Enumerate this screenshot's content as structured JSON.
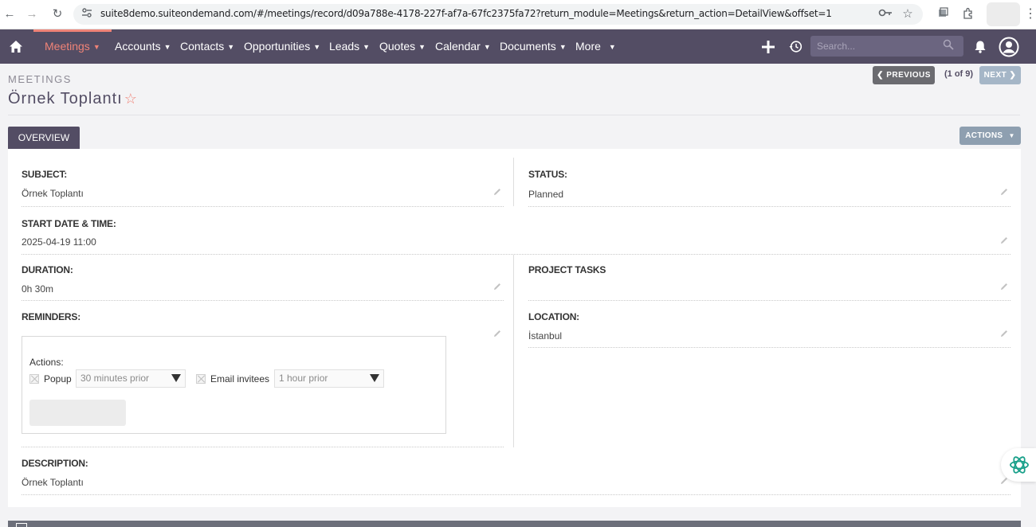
{
  "browser": {
    "url": "suite8demo.suiteondemand.com/#/meetings/record/d09a788e-4178-227f-af7a-67fc2375fa72?return_module=Meetings&return_action=DetailView&offset=1"
  },
  "nav": {
    "items": [
      {
        "label": "Meetings",
        "active": true
      },
      {
        "label": "Accounts"
      },
      {
        "label": "Contacts"
      },
      {
        "label": "Opportunities"
      },
      {
        "label": "Leads"
      },
      {
        "label": "Quotes"
      },
      {
        "label": "Calendar"
      },
      {
        "label": "Documents"
      },
      {
        "label": "More"
      }
    ],
    "search_placeholder": "Search...",
    "accent_color": "#f08377",
    "bar_color": "#534d64"
  },
  "header": {
    "module": "MEETINGS",
    "title": "Örnek Toplantı",
    "pager": {
      "previous": "PREVIOUS",
      "count": "(1 of 9)",
      "next": "NEXT"
    }
  },
  "tabs": {
    "overview": "OVERVIEW",
    "actions": "ACTIONS"
  },
  "fields": {
    "subject_label": "SUBJECT:",
    "subject_value": "Örnek Toplantı",
    "status_label": "STATUS:",
    "status_value": "Planned",
    "start_label": "START DATE & TIME:",
    "start_value": "2025-04-19 11:00",
    "duration_label": "DURATION:",
    "duration_value": "0h 30m",
    "project_tasks_label": "PROJECT TASKS",
    "reminders_label": "REMINDERS:",
    "location_label": "LOCATION:",
    "location_value": "İstanbul",
    "description_label": "DESCRIPTION:",
    "description_value": "Örnek Toplantı"
  },
  "reminders": {
    "actions_label": "Actions:",
    "popup_label": "Popup",
    "popup_select": "30 minutes prior",
    "email_label": "Email invitees",
    "email_select": "1 hour prior"
  }
}
